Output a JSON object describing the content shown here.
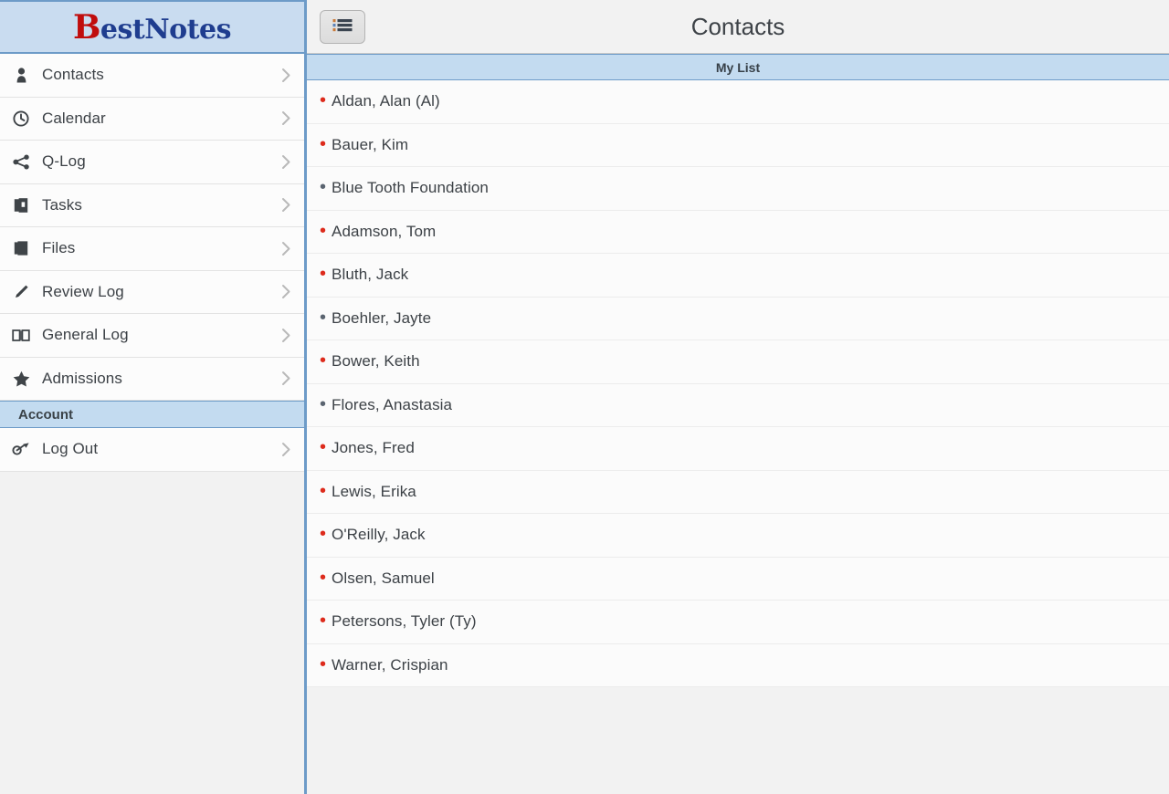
{
  "brand": {
    "initial": "B",
    "rest": "estNotes",
    "initial_color": "#c00d0d",
    "rest_color": "#1f3d8f"
  },
  "sidebar": {
    "items": [
      {
        "label": "Contacts",
        "icon": "person-icon"
      },
      {
        "label": "Calendar",
        "icon": "clock-icon"
      },
      {
        "label": "Q-Log",
        "icon": "share-icon"
      },
      {
        "label": "Tasks",
        "icon": "tasks-icon"
      },
      {
        "label": "Files",
        "icon": "files-icon"
      },
      {
        "label": "Review Log",
        "icon": "pencil-icon"
      },
      {
        "label": "General Log",
        "icon": "book-icon"
      },
      {
        "label": "Admissions",
        "icon": "star-icon"
      }
    ],
    "account_section": "Account",
    "account_items": [
      {
        "label": "Log Out",
        "icon": "logout-icon"
      }
    ]
  },
  "topbar": {
    "list_button_icon": "list-view-icon",
    "title": "Contacts"
  },
  "list": {
    "header": "My List",
    "bullet_colors": {
      "red": "#dd2b1c",
      "gray": "#5a6470"
    },
    "contacts": [
      {
        "name": "Aldan, Alan (Al)",
        "bullet": "red"
      },
      {
        "name": "Bauer, Kim",
        "bullet": "red"
      },
      {
        "name": "Blue Tooth Foundation",
        "bullet": "gray"
      },
      {
        "name": "Adamson, Tom",
        "bullet": "red"
      },
      {
        "name": "Bluth, Jack",
        "bullet": "red"
      },
      {
        "name": "Boehler, Jayte",
        "bullet": "gray"
      },
      {
        "name": "Bower, Keith",
        "bullet": "red"
      },
      {
        "name": "Flores, Anastasia",
        "bullet": "gray"
      },
      {
        "name": "Jones, Fred",
        "bullet": "red"
      },
      {
        "name": "Lewis, Erika",
        "bullet": "red"
      },
      {
        "name": "O'Reilly, Jack",
        "bullet": "red"
      },
      {
        "name": "Olsen, Samuel",
        "bullet": "red"
      },
      {
        "name": "Petersons, Tyler (Ty)",
        "bullet": "red"
      },
      {
        "name": "Warner, Crispian",
        "bullet": "red"
      }
    ]
  },
  "theme": {
    "accent_blue": "#6d9bc8",
    "header_blue": "#c3dbf0",
    "logo_blue": "#c9dcf0",
    "row_bg": "#fbfbfb",
    "page_bg": "#f2f2f2"
  }
}
